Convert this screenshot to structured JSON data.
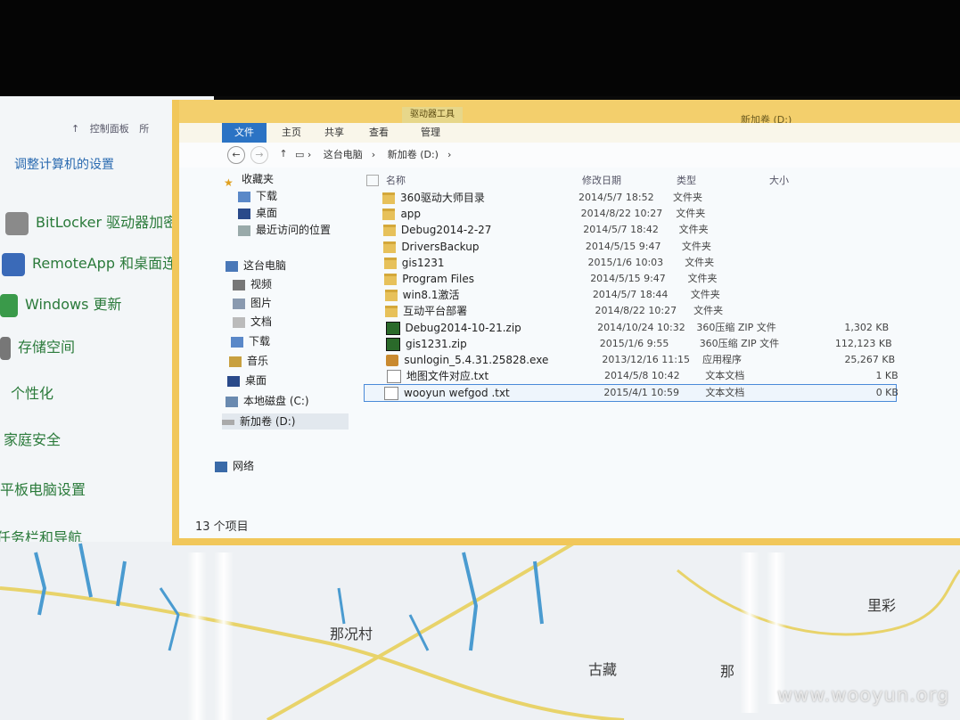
{
  "control_panel": {
    "nav": [
      "控制面板",
      "所"
    ],
    "title": "调整计算机的设置",
    "items": [
      "BitLocker 驱动器加密",
      "RemoteApp 和桌面连接",
      "Windows 更新",
      "存储空间",
      "个性化",
      "家庭安全",
      "平板电脑设置",
      "任务栏和导航"
    ]
  },
  "explorer": {
    "context_tab": "驱动器工具",
    "window_title": "新加卷 (D:)",
    "ribbon_tabs": [
      "文件",
      "主页",
      "共享",
      "查看",
      "管理"
    ],
    "breadcrumb": [
      "这台电脑",
      "新加卷 (D:)"
    ],
    "nav_pane": {
      "favorites_header": "收藏夹",
      "favorites": [
        "下载",
        "桌面",
        "最近访问的位置"
      ],
      "this_pc_header": "这台电脑",
      "this_pc": [
        "视频",
        "图片",
        "文档",
        "下载",
        "音乐",
        "桌面",
        "本地磁盘 (C:)",
        "新加卷 (D:)"
      ],
      "network": "网络"
    },
    "columns": [
      "名称",
      "修改日期",
      "类型",
      "大小"
    ],
    "files": [
      {
        "name": "360驱动大师目录",
        "date": "2014/5/7 18:52",
        "type": "文件夹",
        "size": "",
        "icon": "folder"
      },
      {
        "name": "app",
        "date": "2014/8/22 10:27",
        "type": "文件夹",
        "size": "",
        "icon": "folder"
      },
      {
        "name": "Debug2014-2-27",
        "date": "2014/5/7 18:42",
        "type": "文件夹",
        "size": "",
        "icon": "folder"
      },
      {
        "name": "DriversBackup",
        "date": "2014/5/15 9:47",
        "type": "文件夹",
        "size": "",
        "icon": "folder"
      },
      {
        "name": "gis1231",
        "date": "2015/1/6 10:03",
        "type": "文件夹",
        "size": "",
        "icon": "folder"
      },
      {
        "name": "Program Files",
        "date": "2014/5/15 9:47",
        "type": "文件夹",
        "size": "",
        "icon": "folder"
      },
      {
        "name": "win8.1激活",
        "date": "2014/5/7 18:44",
        "type": "文件夹",
        "size": "",
        "icon": "folder"
      },
      {
        "name": "互动平台部署",
        "date": "2014/8/22 10:27",
        "type": "文件夹",
        "size": "",
        "icon": "folder"
      },
      {
        "name": "Debug2014-10-21.zip",
        "date": "2014/10/24 10:32",
        "type": "360压缩 ZIP 文件",
        "size": "1,302 KB",
        "icon": "zip"
      },
      {
        "name": "gis1231.zip",
        "date": "2015/1/6 9:55",
        "type": "360压缩 ZIP 文件",
        "size": "112,123 KB",
        "icon": "zip"
      },
      {
        "name": "sunlogin_5.4.31.25828.exe",
        "date": "2013/12/16 11:15",
        "type": "应用程序",
        "size": "25,267 KB",
        "icon": "exe"
      },
      {
        "name": "地图文件对应.txt",
        "date": "2014/5/8 10:42",
        "type": "文本文档",
        "size": "1 KB",
        "icon": "txt"
      },
      {
        "name": "wooyun wefgod .txt",
        "date": "2015/4/1 10:59",
        "type": "文本文档",
        "size": "0 KB",
        "icon": "txt",
        "selected": true
      }
    ],
    "status": "13 个项目"
  },
  "map": {
    "labels": [
      "那况村",
      "古藏",
      "里彩",
      "那罗",
      "那"
    ]
  },
  "watermark": "www.wooyun.org",
  "colors": {
    "window_border": "#f1c75a",
    "file_tab": "#2b73c4",
    "selection": "#4a8ad8"
  }
}
